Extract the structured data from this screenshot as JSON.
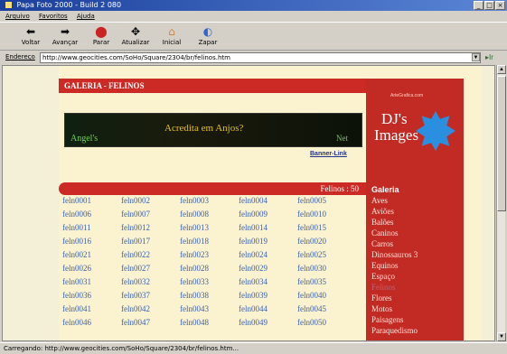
{
  "window": {
    "title": "Papa Foto 2000 - Build 2 080"
  },
  "menu": [
    "Arquivo",
    "Favoritos",
    "Ajuda"
  ],
  "toolbar": {
    "back": "Voltar",
    "forward": "Avançar",
    "stop": "Parar",
    "refresh": "Atualizar",
    "home": "Inicial",
    "clear": "Zapar"
  },
  "address": {
    "label": "Endereço",
    "url": "http://www.geocities.com/SoHo/Square/2304/br/felinos.htm"
  },
  "status": "Carregando: http://www.geocities.com/SoHo/Square/2304/br/felinos.htm...",
  "page": {
    "header": "GALERIA - FELINOS",
    "banner": {
      "left": "Angel's",
      "middle": "Acredita em Anjos?",
      "right": "Net"
    },
    "banner_link": "Banner-Link",
    "logo": {
      "title_line1": "DJ's",
      "title_line2": "Images",
      "caption": "ArteGrafica.com"
    },
    "felinos_count": "Felinos : 50",
    "links": [
      "feln0001",
      "feln0002",
      "feln0003",
      "feln0004",
      "feln0005",
      "feln0006",
      "feln0007",
      "feln0008",
      "feln0009",
      "feln0010",
      "feln0011",
      "feln0012",
      "feln0013",
      "feln0014",
      "feln0015",
      "feln0016",
      "feln0017",
      "feln0018",
      "feln0019",
      "feln0020",
      "feln0021",
      "feln0022",
      "feln0023",
      "feln0024",
      "feln0025",
      "feln0026",
      "feln0027",
      "feln0028",
      "feln0029",
      "feln0030",
      "feln0031",
      "feln0032",
      "feln0033",
      "feln0034",
      "feln0035",
      "feln0036",
      "feln0037",
      "feln0038",
      "feln0039",
      "feln0040",
      "feln0041",
      "feln0042",
      "feln0043",
      "feln0044",
      "feln0045",
      "feln0046",
      "feln0047",
      "feln0048",
      "feln0049",
      "feln0050"
    ],
    "gallery_title": "Galeria",
    "gallery": [
      "Aves",
      "Aviões",
      "Balões",
      "Caninos",
      "Carros",
      "Dinossauros 3",
      "Equinos",
      "Espaço",
      "Felinos",
      "Flores",
      "Motos",
      "Paisagens",
      "Paraquedismo"
    ]
  }
}
